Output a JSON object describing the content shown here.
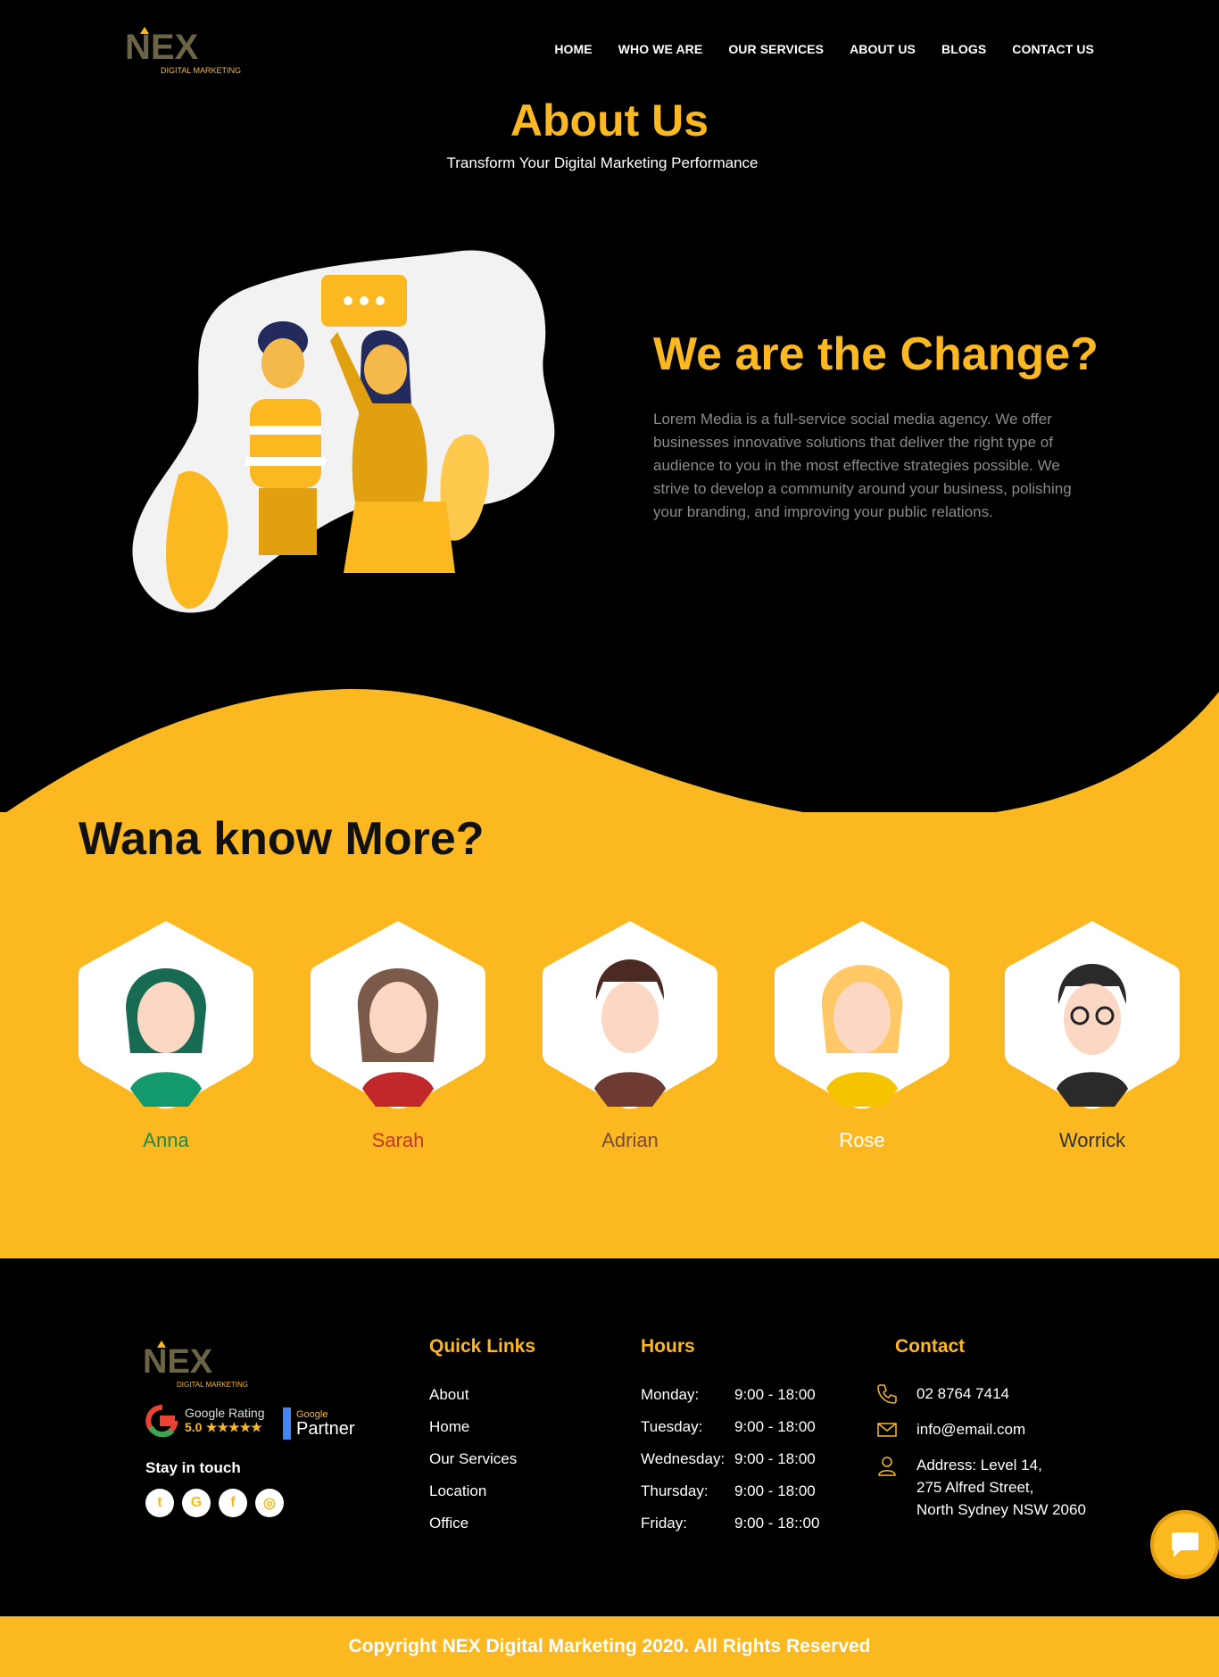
{
  "header": {
    "logo_text": "NEX",
    "logo_sub": "DIGITAL MARKETING",
    "nav": [
      "HOME",
      "WHO WE ARE",
      "OUR SERVICES",
      "ABOUT US",
      "BLOGS",
      "CONTACT US"
    ]
  },
  "hero": {
    "title": "About Us",
    "subtitle": "Transform Your Digital Marketing Performance"
  },
  "about": {
    "title": "We are the Change?",
    "text": "Lorem Media is a full-service social media agency. We offer businesses innovative solutions that deliver the right type of audience to you in the most effective strategies possible. We strive to develop a community around your business, polishing your branding, and improving your public relations."
  },
  "team": {
    "title": "Wana know More?",
    "members": [
      {
        "name": "Anna",
        "color": "#1a8a4a"
      },
      {
        "name": "Sarah",
        "color": "#c0392b"
      },
      {
        "name": "Adrian",
        "color": "#7a4a3a"
      },
      {
        "name": "Rose",
        "color": "#ffffff"
      },
      {
        "name": "Worrick",
        "color": "#333333"
      }
    ]
  },
  "footer": {
    "logo_text": "NEX",
    "logo_sub": "DIGITAL MARKETING",
    "rating_label": "Google Rating",
    "rating_value": "5.0",
    "rating_stars": "★★★★★",
    "partner_small": "Google",
    "partner_big": "Partner",
    "stay": "Stay in touch",
    "socials": [
      "twitter-icon",
      "google-plus-icon",
      "facebook-icon",
      "instagram-icon"
    ],
    "quick_title": "Quick Links",
    "quick_links": [
      "About",
      "Home",
      "Our Services",
      "Location",
      "Office"
    ],
    "hours_title": "Hours",
    "hours": [
      {
        "day": "Monday:",
        "time": "9:00 - 18:00"
      },
      {
        "day": "Tuesday:",
        "time": "9:00 - 18:00"
      },
      {
        "day": "Wednesday:",
        "time": "9:00 - 18:00"
      },
      {
        "day": "Thursday:",
        "time": "9:00 - 18:00"
      },
      {
        "day": "Friday:",
        "time": "9:00 - 18::00"
      }
    ],
    "contact_title": "Contact",
    "phone": "02 8764 7414",
    "email": "info@email.com",
    "address_1": "Address: Level 14,",
    "address_2": "275 Alfred Street,",
    "address_3": "North Sydney NSW 2060",
    "copyright": "Copyright NEX Digital Marketing 2020. All Rights Reserved"
  },
  "colors": {
    "accent": "#fbb820",
    "background": "#000000"
  }
}
